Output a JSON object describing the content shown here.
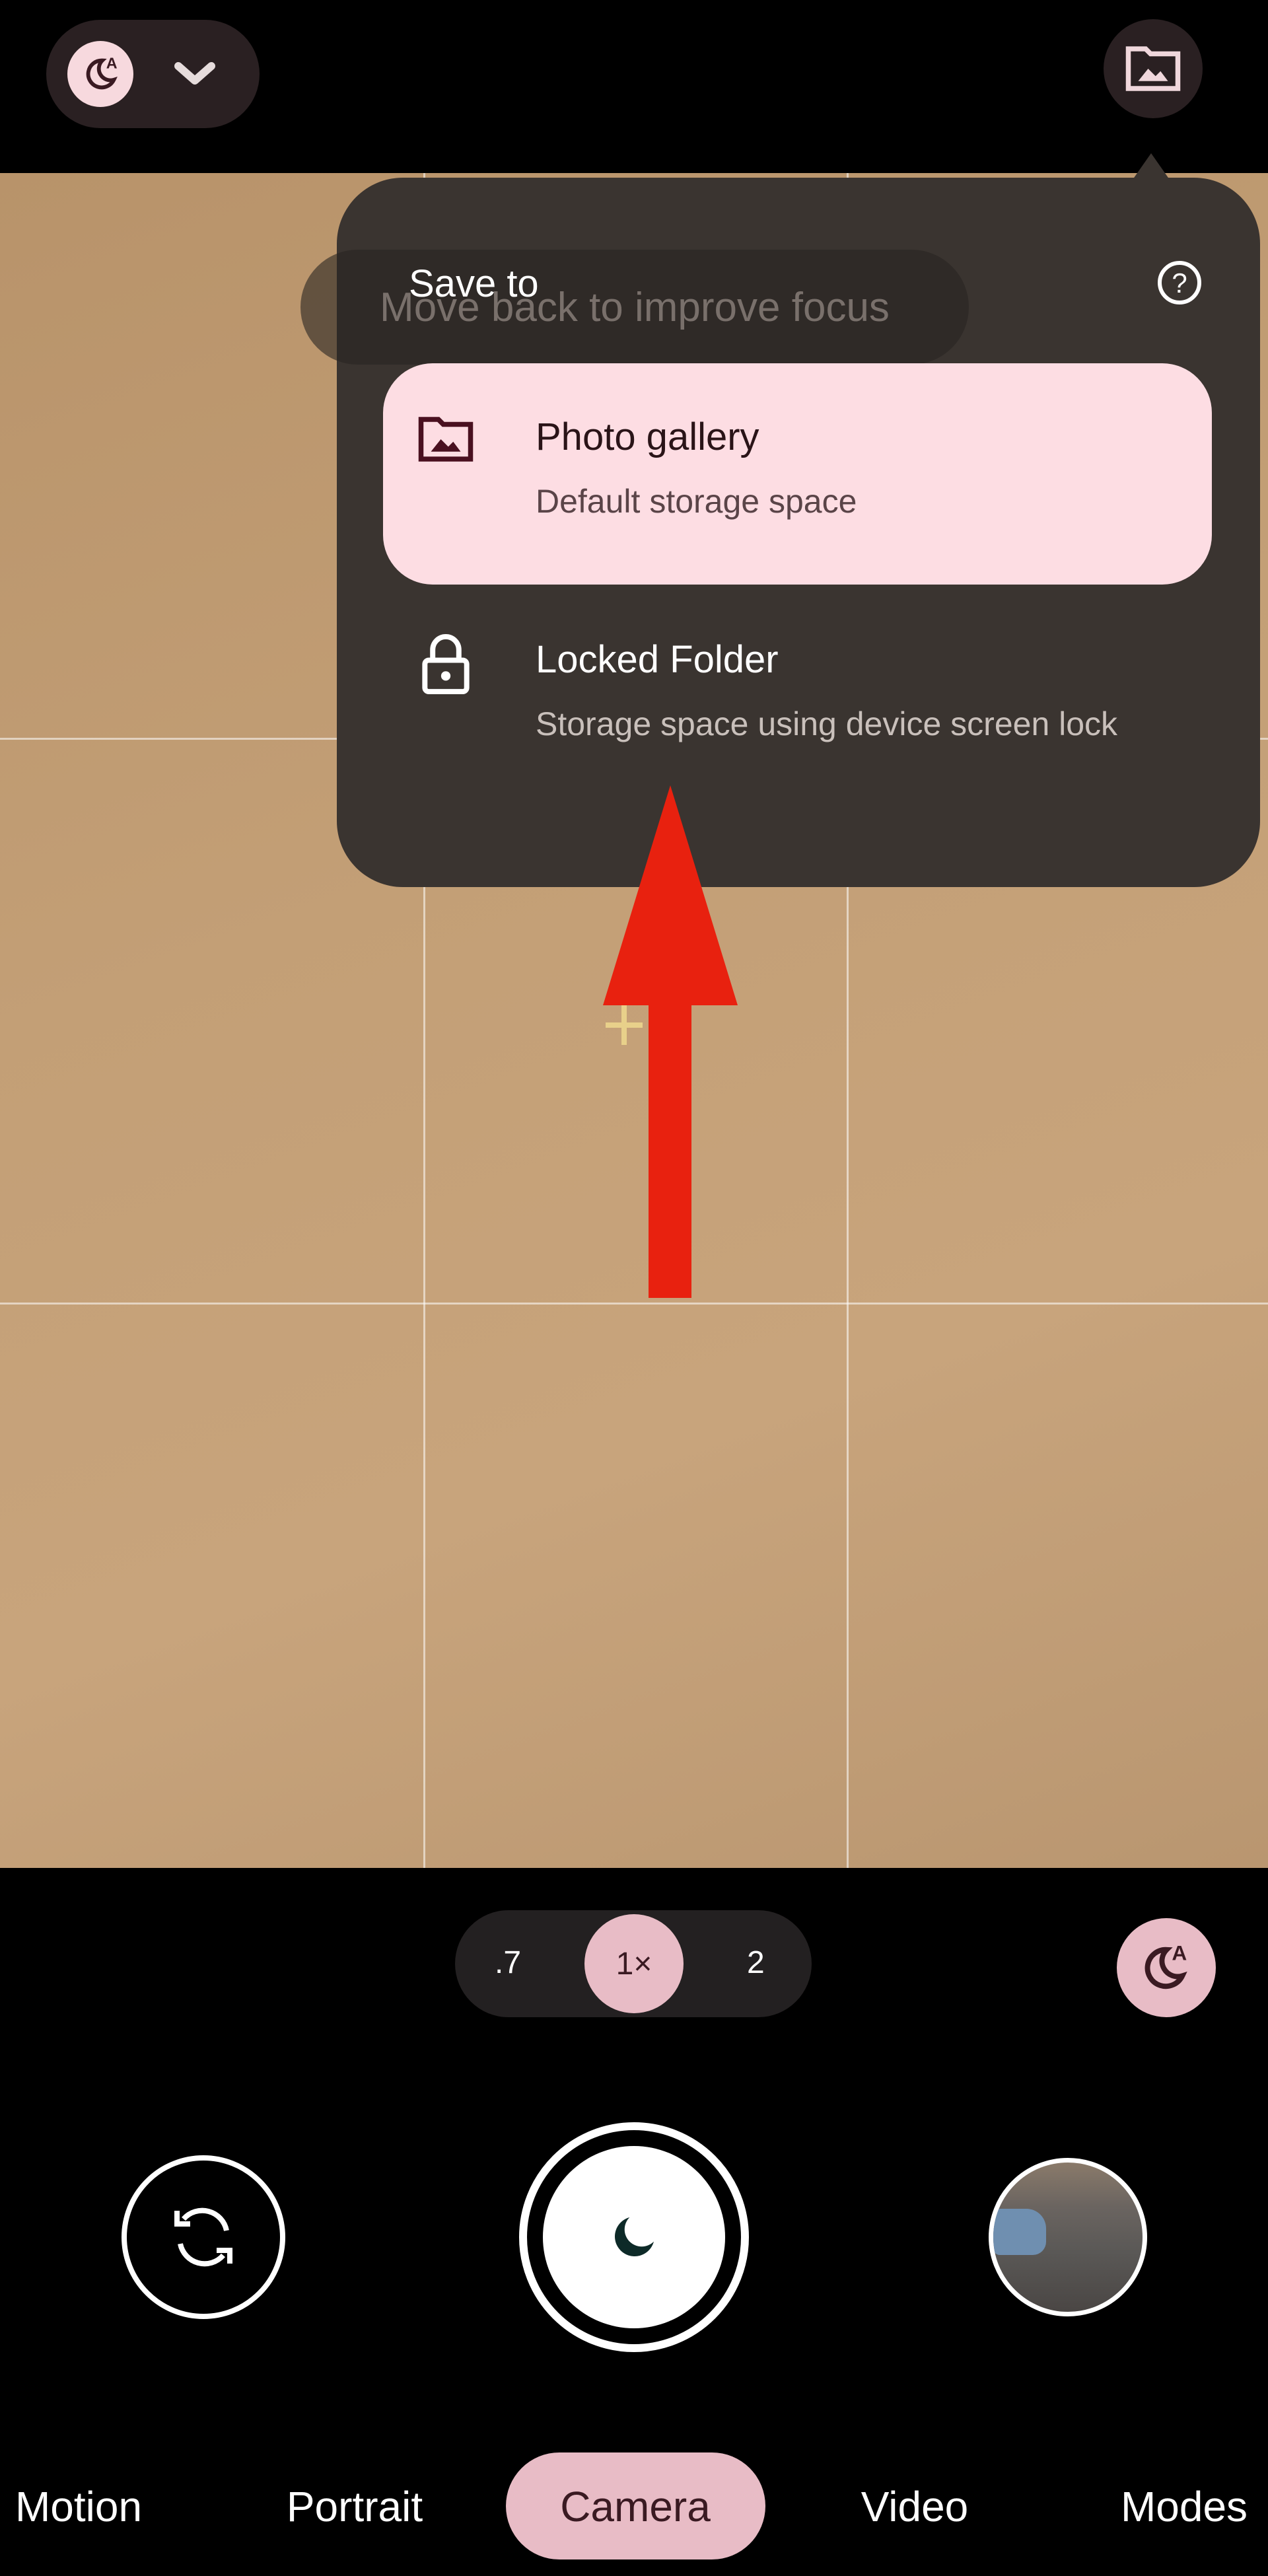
{
  "top_bar": {
    "night_mode_icon": "night-auto-icon",
    "dropdown_icon": "chevron-down-icon",
    "save_location_icon": "folder-image-icon"
  },
  "toast": {
    "text": "Move back to improve focus"
  },
  "save_to_menu": {
    "title": "Save to",
    "help_icon": "help-circle-icon",
    "options": [
      {
        "title": "Photo gallery",
        "subtitle": "Default storage space",
        "icon": "folder-image-icon",
        "selected": true
      },
      {
        "title": "Locked Folder",
        "subtitle": "Storage space using device screen lock",
        "icon": "lock-icon",
        "selected": false
      }
    ]
  },
  "zoom": {
    "options": [
      ".7",
      "1×",
      "2"
    ],
    "selected": "1×"
  },
  "modes": {
    "items": [
      "Motion",
      "Portrait",
      "Camera",
      "Video",
      "Modes"
    ],
    "selected": "Camera"
  },
  "colors": {
    "accent": "#f7d9de",
    "selected_card": "#fddde3",
    "menu_bg": "#3a3430",
    "annotation_arrow": "#e8210f"
  }
}
